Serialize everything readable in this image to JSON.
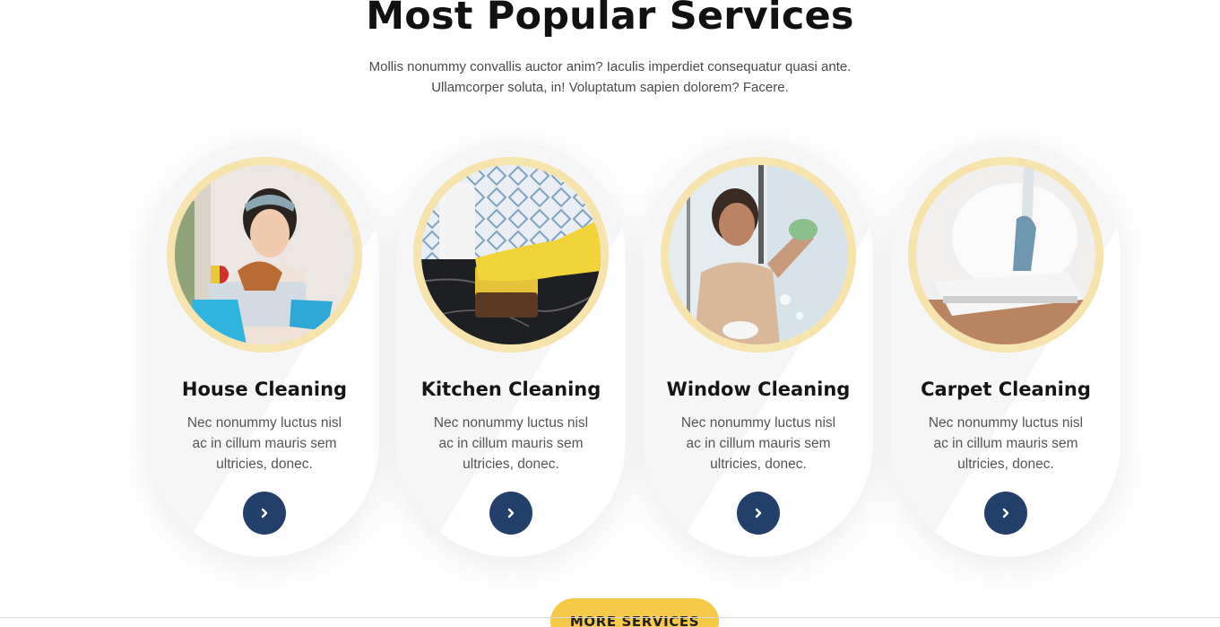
{
  "section": {
    "title": "Most Popular Services",
    "subtitle_line1": "Mollis nonummy convallis auctor anim? Iaculis imperdiet consequatur quasi ante.",
    "subtitle_line2": "Ullamcorper soluta, in! Voluptatum sapien dolorem? Facere."
  },
  "services": [
    {
      "title": "House Cleaning",
      "desc_line1": "Nec nonummy luctus nisl",
      "desc_line2": "ac in cillum mauris sem",
      "desc_line3": "ultricies, donec.",
      "image": "woman-holding-cleaning-supplies-photo"
    },
    {
      "title": "Kitchen Cleaning",
      "desc_line1": "Nec nonummy luctus nisl",
      "desc_line2": "ac in cillum mauris sem",
      "desc_line3": "ultricies, donec.",
      "image": "gloved-hand-scrubbing-counter-photo"
    },
    {
      "title": "Window Cleaning",
      "desc_line1": "Nec nonummy luctus nisl",
      "desc_line2": "ac in cillum mauris sem",
      "desc_line3": "ultricies, donec.",
      "image": "woman-cleaning-glass-window-photo"
    },
    {
      "title": "Carpet Cleaning",
      "desc_line1": "Nec nonummy luctus nisl",
      "desc_line2": "ac in cillum mauris sem",
      "desc_line3": "ultricies, donec.",
      "image": "steam-mop-on-floor-photo"
    }
  ],
  "card_button_icon": "chevron-right-icon",
  "more_button_label": "MORE SERVICES",
  "colors": {
    "accent_yellow": "#f7c948",
    "ring_yellow": "#f7e3ae",
    "button_navy": "#22406a",
    "card_bg": "#f6f6f6"
  }
}
